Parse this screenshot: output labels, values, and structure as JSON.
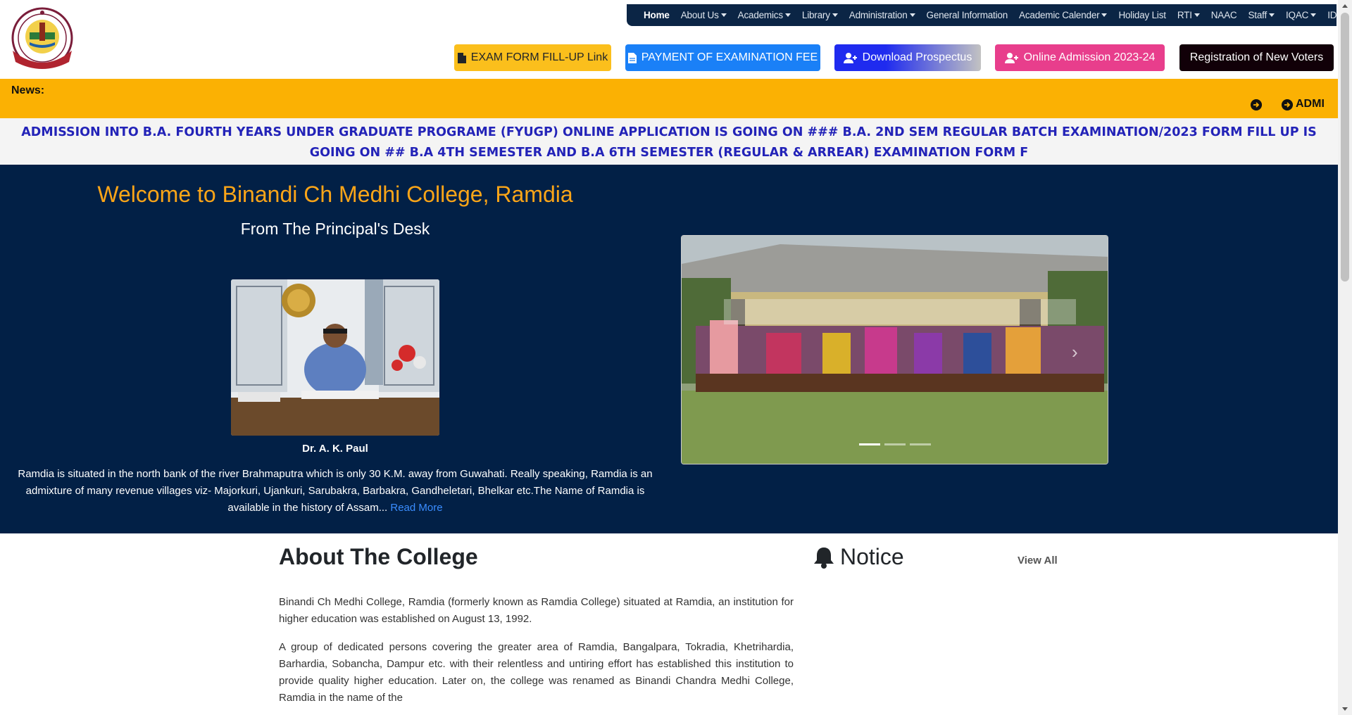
{
  "nav": {
    "items": [
      {
        "label": "Home",
        "active": true,
        "dropdown": false
      },
      {
        "label": "About Us",
        "dropdown": true
      },
      {
        "label": "Academics",
        "dropdown": true
      },
      {
        "label": "Library",
        "dropdown": true
      },
      {
        "label": "Administration",
        "dropdown": true
      },
      {
        "label": "General Information",
        "dropdown": false
      },
      {
        "label": "Academic Calender",
        "dropdown": true
      },
      {
        "label": "Holiday List",
        "dropdown": false
      },
      {
        "label": "RTI",
        "dropdown": true
      },
      {
        "label": "NAAC",
        "dropdown": false
      },
      {
        "label": "Staff",
        "dropdown": true
      },
      {
        "label": "IQAC",
        "dropdown": true
      },
      {
        "label": "IDP",
        "dropdown": true
      }
    ]
  },
  "buttons": {
    "exam_form": "EXAM FORM FILL-UP Link",
    "payment": "PAYMENT OF EXAMINATION FEE",
    "prospectus": "Download Prospectus",
    "admission": "Online Admission 2023-24",
    "voters": "Registration of New Voters"
  },
  "news": {
    "label": "News:",
    "ticker": "ADMI"
  },
  "marquee": {
    "text": "ADMISSION INTO B.A. FOURTH YEARS UNDER GRADUATE PROGRAME (FYUGP) ONLINE APPLICATION IS GOING ON ### B.A. 2ND SEM REGULAR BATCH EXAMINATION/2023 FORM FILL UP IS GOING ON ## B.A 4TH SEMESTER AND B.A 6TH SEMESTER (REGULAR & ARREAR) EXAMINATION FORM F"
  },
  "hero": {
    "welcome": "Welcome to Binandi Ch Medhi College, Ramdia",
    "desk": "From The Principal's Desk",
    "principal_name": "Dr. A. K. Paul",
    "principal_text": "Ramdia is situated in the north bank of the river Brahmaputra which is only 30 K.M. away from Guwahati. Really speaking, Ramdia is an admixture of many revenue villages viz- Majorkuri, Ujankuri, Sarubakra, Barbakra, Gandheletari, Bhelkar etc.The Name of Ramdia is available in the history of Assam...",
    "read_more": "Read More"
  },
  "about": {
    "title": "About The College",
    "p1": "Binandi Ch Medhi College, Ramdia (formerly known as Ramdia College) situated at Ramdia, an institution for higher education was established on August 13, 1992.",
    "p2": "A group of dedicated persons covering the greater area of Ramdia, Bangalpara, Tokradia, Khetrihardia, Barhardia, Sobancha, Dampur etc. with their relentless and untiring effort has established this institution to provide quality higher education. Later on, the college was renamed as Binandi Chandra Medhi College, Ramdia in the name of the"
  },
  "notice": {
    "title": "Notice",
    "view_all": "View All"
  },
  "colors": {
    "nav_bg": "#0b2545",
    "hero_bg": "#022046",
    "news_bg": "#fbb103",
    "welcome": "#fba518",
    "marquee_text": "#2323b8"
  }
}
